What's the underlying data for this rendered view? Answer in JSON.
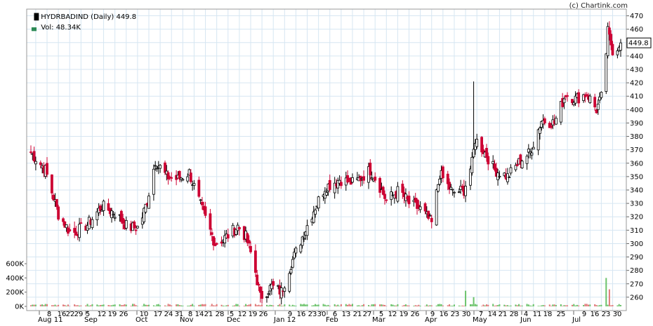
{
  "header": {
    "symbol_line": "HYDRBADIND (Daily) 449.8",
    "volume_line": "Vol: 48.34K",
    "copyright": "(c) Chartink.com"
  },
  "colors": {
    "up": "#000000",
    "down": "#cc0033",
    "grid": "#d6e6f2",
    "vol_up": "#6cc36c",
    "vol_down": "#e07a7a"
  },
  "chart_data": {
    "type": "candlestick",
    "ylim": [
      250,
      475
    ],
    "y_ticks": [
      260,
      270,
      280,
      290,
      300,
      310,
      320,
      330,
      340,
      350,
      360,
      370,
      380,
      390,
      400,
      410,
      420,
      430,
      440,
      450,
      460,
      470
    ],
    "last_price_label": "449.8",
    "volume_ticks": [
      "0K",
      "200K",
      "400K",
      "600K"
    ],
    "volume_max": 700000,
    "x_labels": [
      "Aug 11",
      "8",
      "16",
      "22",
      "29",
      "5",
      "Sep",
      "12",
      "19",
      "26",
      "Oct",
      "10",
      "17",
      "24",
      "31",
      "Nov",
      "8",
      "14",
      "21",
      "28",
      "Dec",
      "5",
      "12",
      "19",
      "26",
      "Jan 12",
      "9",
      "16",
      "23",
      "30",
      "Feb",
      "6",
      "13",
      "21",
      "27",
      "Mar",
      "5",
      "12",
      "19",
      "26",
      "Apr",
      "9",
      "16",
      "23",
      "30",
      "May",
      "7",
      "14",
      "21",
      "28",
      "Jun",
      "4",
      "11",
      "18",
      "25",
      "Jul",
      "9",
      "16",
      "23",
      "30"
    ],
    "monthly_close_anchors": [
      {
        "date": "Aug 1",
        "close": 368
      },
      {
        "date": "Aug 10",
        "close": 355
      },
      {
        "date": "Aug 18",
        "close": 322
      },
      {
        "date": "Aug 26",
        "close": 307
      },
      {
        "date": "Sep 5",
        "close": 314
      },
      {
        "date": "Sep 14",
        "close": 328
      },
      {
        "date": "Sep 23",
        "close": 322
      },
      {
        "date": "Sep 30",
        "close": 312
      },
      {
        "date": "Oct 7",
        "close": 312
      },
      {
        "date": "Oct 12",
        "close": 332
      },
      {
        "date": "Oct 17",
        "close": 362
      },
      {
        "date": "Oct 24",
        "close": 350
      },
      {
        "date": "Oct 31",
        "close": 348
      },
      {
        "date": "Nov 7",
        "close": 353
      },
      {
        "date": "Nov 15",
        "close": 325
      },
      {
        "date": "Nov 23",
        "close": 300
      },
      {
        "date": "Nov 30",
        "close": 305
      },
      {
        "date": "Dec 7",
        "close": 313
      },
      {
        "date": "Dec 12",
        "close": 305
      },
      {
        "date": "Dec 17",
        "close": 285
      },
      {
        "date": "Dec 21",
        "close": 260
      },
      {
        "date": "Dec 28",
        "close": 268
      },
      {
        "date": "Jan 3",
        "close": 264
      },
      {
        "date": "Jan 9",
        "close": 285
      },
      {
        "date": "Jan 16",
        "close": 305
      },
      {
        "date": "Jan 23",
        "close": 325
      },
      {
        "date": "Jan 30",
        "close": 342
      },
      {
        "date": "Feb 8",
        "close": 348
      },
      {
        "date": "Feb 17",
        "close": 345
      },
      {
        "date": "Feb 27",
        "close": 355
      },
      {
        "date": "Mar 3",
        "close": 345
      },
      {
        "date": "Mar 8",
        "close": 332
      },
      {
        "date": "Mar 16",
        "close": 340
      },
      {
        "date": "Mar 22",
        "close": 330
      },
      {
        "date": "Mar 30",
        "close": 325
      },
      {
        "date": "Apr 5",
        "close": 315
      },
      {
        "date": "Apr 10",
        "close": 352
      },
      {
        "date": "Apr 18",
        "close": 338
      },
      {
        "date": "Apr 25",
        "close": 340
      },
      {
        "date": "Apr 30",
        "close": 360
      },
      {
        "date": "May 2",
        "close": 378
      },
      {
        "date": "May 8",
        "close": 368
      },
      {
        "date": "May 14",
        "close": 355
      },
      {
        "date": "May 22",
        "close": 350
      },
      {
        "date": "May 30",
        "close": 362
      },
      {
        "date": "Jun 5",
        "close": 368
      },
      {
        "date": "Jun 12",
        "close": 392
      },
      {
        "date": "Jun 20",
        "close": 390
      },
      {
        "date": "Jun 27",
        "close": 412
      },
      {
        "date": "Jul 3",
        "close": 408
      },
      {
        "date": "Jul 10",
        "close": 412
      },
      {
        "date": "Jul 16",
        "close": 400
      },
      {
        "date": "Jul 20",
        "close": 412
      },
      {
        "date": "Jul 23",
        "close": 458
      },
      {
        "date": "Jul 27",
        "close": 440
      },
      {
        "date": "Jul 30",
        "close": 449.8
      }
    ],
    "notable_points": [
      {
        "date": "May 1",
        "high": 421,
        "note": "spike"
      },
      {
        "date": "Jul 23",
        "high": 465,
        "note": "high"
      },
      {
        "date": "Dec 21",
        "low": 256,
        "note": "low"
      }
    ],
    "volume_spikes": [
      {
        "date": "Apr 26",
        "volume": 220000
      },
      {
        "date": "May 1",
        "volume": 130000
      },
      {
        "date": "Jul 22",
        "volume": 400000
      },
      {
        "date": "Jul 24",
        "volume": 240000
      }
    ]
  }
}
